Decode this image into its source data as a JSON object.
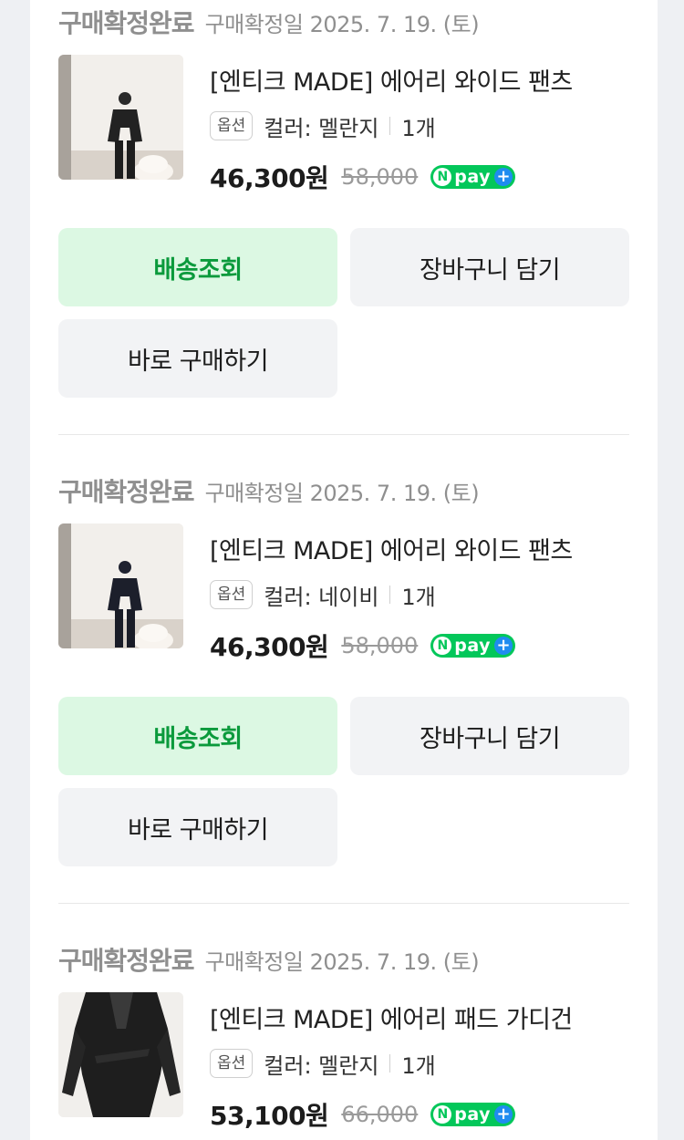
{
  "colors": {
    "status_gray": "#8f8f8f",
    "track_bg": "#dcf8e3",
    "track_text": "#0b9a3c",
    "button_bg": "#f2f3f5",
    "npay_green": "#03c75a",
    "npay_plus_blue": "#1f8cf0"
  },
  "orders": [
    {
      "status": "구매확정완료",
      "date": "구매확정일 2025. 7. 19. (토)",
      "product_name": "[엔티크 MADE] 에어리 와이드 팬츠",
      "option_badge": "옵션",
      "option_color": "컬러: 멜란지",
      "quantity": "1개",
      "price": "46,300원",
      "original_price": "58,000",
      "npay_label": "pay",
      "buttons": {
        "track": "배송조회",
        "cart": "장바구니 담기",
        "buy": "바로 구매하기"
      }
    },
    {
      "status": "구매확정완료",
      "date": "구매확정일 2025. 7. 19. (토)",
      "product_name": "[엔티크 MADE] 에어리 와이드 팬츠",
      "option_badge": "옵션",
      "option_color": "컬러: 네이비",
      "quantity": "1개",
      "price": "46,300원",
      "original_price": "58,000",
      "npay_label": "pay",
      "buttons": {
        "track": "배송조회",
        "cart": "장바구니 담기",
        "buy": "바로 구매하기"
      }
    },
    {
      "status": "구매확정완료",
      "date": "구매확정일 2025. 7. 19. (토)",
      "product_name": "[엔티크 MADE] 에어리 패드 가디건",
      "option_badge": "옵션",
      "option_color": "컬러: 멜란지",
      "quantity": "1개",
      "price": "53,100원",
      "original_price": "66,000",
      "npay_label": "pay"
    }
  ]
}
